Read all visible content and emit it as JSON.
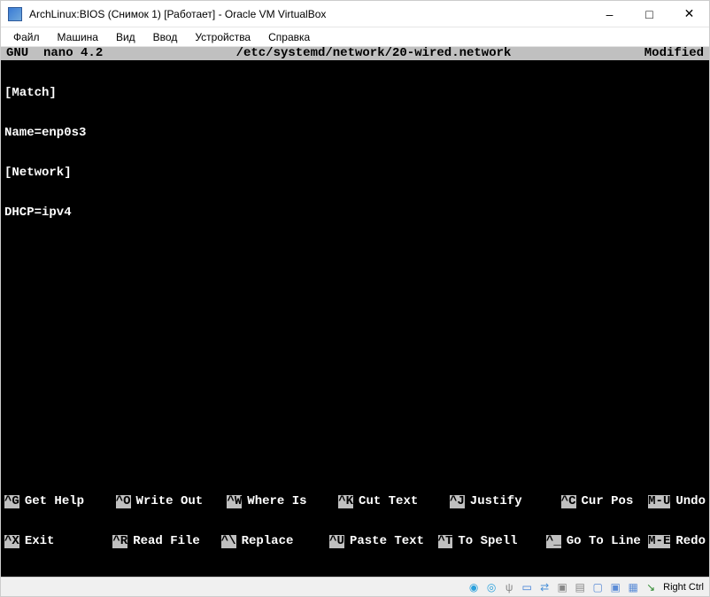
{
  "window": {
    "title": "ArchLinux:BIOS (Снимок 1) [Работает] - Oracle VM VirtualBox"
  },
  "menu": {
    "file": "Файл",
    "machine": "Машина",
    "view": "Вид",
    "input": "Ввод",
    "devices": "Устройства",
    "help": "Справка"
  },
  "nano": {
    "version": "GNU  nano 4.2",
    "filename": "/etc/systemd/network/20-wired.network",
    "modified": "Modified",
    "lines": {
      "l1": "[Match]",
      "l2": "Name=enp0s3",
      "l3": "[Network]",
      "l4": "DHCP=ipv4"
    },
    "shortcuts": {
      "get_help_key": "^G",
      "get_help": "Get Help",
      "exit_key": "^X",
      "exit": "Exit",
      "write_out_key": "^O",
      "write_out": "Write Out",
      "read_file_key": "^R",
      "read_file": "Read File",
      "where_is_key": "^W",
      "where_is": "Where Is",
      "replace_key": "^\\",
      "replace": "Replace",
      "cut_text_key": "^K",
      "cut_text": "Cut Text",
      "paste_text_key": "^U",
      "paste_text": "Paste Text",
      "justify_key": "^J",
      "justify": "Justify",
      "to_spell_key": "^T",
      "to_spell": "To Spell",
      "cur_pos_key": "^C",
      "cur_pos": "Cur Pos",
      "go_to_line_key": "^_",
      "go_to_line": "Go To Line",
      "undo_key": "M-U",
      "undo": "Undo",
      "redo_key": "M-E",
      "redo": "Redo"
    }
  },
  "status": {
    "host_key": "Right Ctrl"
  },
  "icon_colors": {
    "disc": "#29a0dc",
    "usb": "#888",
    "folder": "#3a7bd5",
    "net": "#4a90d9",
    "screen": "#888",
    "clipboard": "#888",
    "displays": "#5a8bd6",
    "record": "#e74c3c",
    "arrow": "#2e882e"
  }
}
